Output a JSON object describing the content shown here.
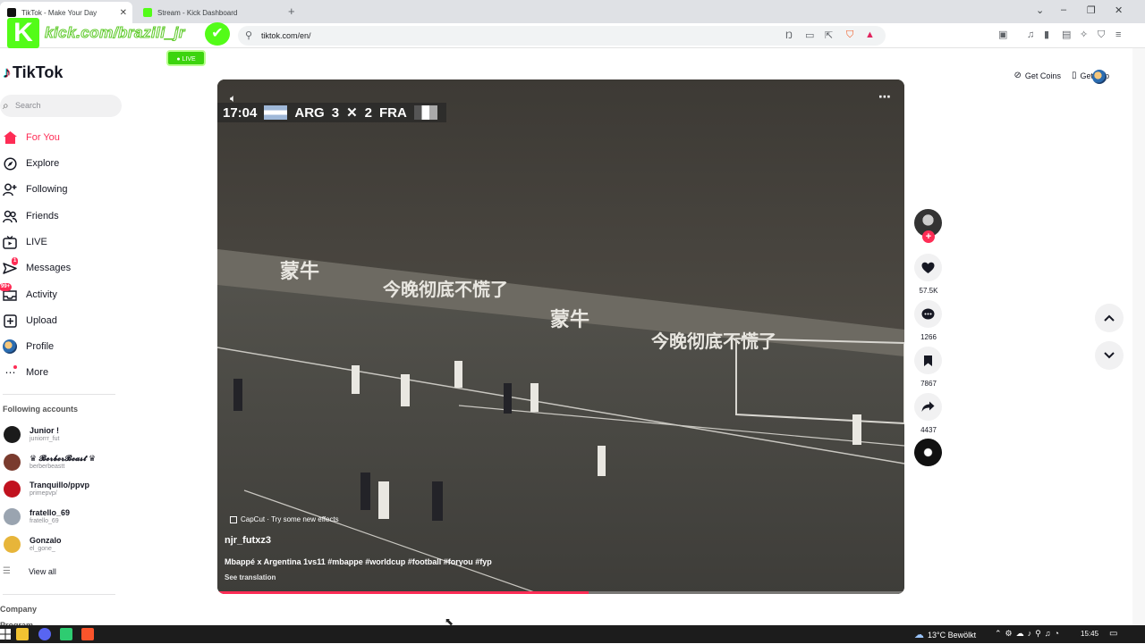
{
  "browser": {
    "tabs": [
      {
        "title": "TikTok - Make Your Day",
        "fav_color": "#111111",
        "active": true
      },
      {
        "title": "Stream - Kick Dashboard",
        "fav_color": "#53fc18",
        "active": false
      }
    ],
    "url": "tiktok.com/en/"
  },
  "overlay": {
    "logo_letter": "K",
    "handle": "kick.com/brazili_jr",
    "live_label": "LIVE"
  },
  "tiktok": {
    "logo_text": "TikTok",
    "search_placeholder": "Search",
    "nav": [
      {
        "label": "For You",
        "icon": "home-icon",
        "glyph": "⌂",
        "active": true
      },
      {
        "label": "Explore",
        "icon": "compass-icon",
        "glyph": "◎"
      },
      {
        "label": "Following",
        "icon": "following-icon",
        "glyph": "⚇"
      },
      {
        "label": "Friends",
        "icon": "friends-icon",
        "glyph": "⚇"
      },
      {
        "label": "LIVE",
        "icon": "live-tv-icon",
        "glyph": "▭"
      },
      {
        "label": "Messages",
        "icon": "send-icon",
        "glyph": "➢",
        "badge": "1"
      },
      {
        "label": "Activity",
        "icon": "inbox-icon",
        "glyph": "▢",
        "badge": "99+"
      },
      {
        "label": "Upload",
        "icon": "upload-icon",
        "glyph": "⊞"
      },
      {
        "label": "Profile",
        "icon": "profile-avatar-icon",
        "glyph": "●"
      },
      {
        "label": "More",
        "icon": "more-icon",
        "glyph": "⋯"
      }
    ],
    "following_title": "Following accounts",
    "accounts": [
      {
        "name": "Junior !",
        "handle": "juniorrr_fut",
        "color": "#1b1b1b"
      },
      {
        "name": "♛ 𝓑𝓮𝓻𝓫𝓮𝓻𝓑𝓮𝓪𝓼𝓽 ♛",
        "handle": "berberbeastt",
        "color": "#7a3b2e"
      },
      {
        "name": "Tranquillo/ppvp",
        "handle": "primepvp/",
        "color": "#c1121f"
      },
      {
        "name": "fratello_69",
        "handle": "fratello_69",
        "color": "#9aa4b0"
      },
      {
        "name": "Gonzalo",
        "handle": "el_gone_",
        "color": "#e7b53a"
      }
    ],
    "view_all": "View all",
    "footer": [
      "Company",
      "Program"
    ],
    "top_right": {
      "get_coins": "Get Coins",
      "get_app": "Get App"
    }
  },
  "video": {
    "scoreboard": {
      "time": "17:04",
      "home": "ARG",
      "home_score": "3",
      "away_score": "2",
      "away": "FRA"
    },
    "effect": "CapCut · Try some new effects",
    "author": "njr_futxz3",
    "caption": "Mbappé x Argentina 1vs11 #mbappe #worldcup #football #foryou #fyp",
    "see_translation": "See translation",
    "progress": 0.54
  },
  "actions": {
    "likes": "57.5K",
    "comments": "1266",
    "saves": "7867",
    "shares": "4437"
  },
  "taskbar": {
    "weather": "13°C  Bewölkt",
    "time": "15:45"
  }
}
